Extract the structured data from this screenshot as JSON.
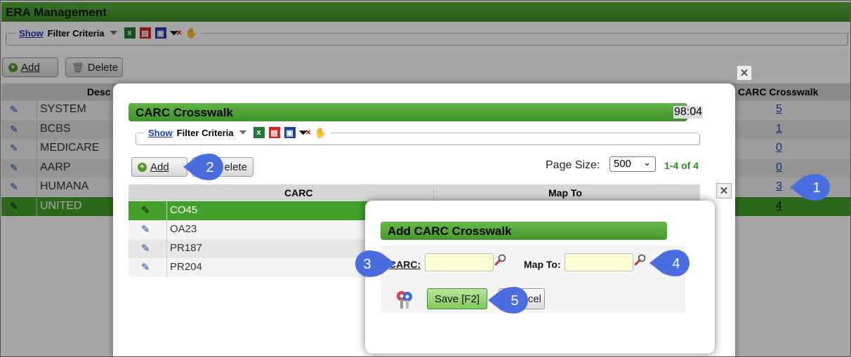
{
  "main": {
    "title": "ERA Management",
    "filter": {
      "show_label": "Show",
      "criteria_label": "Filter Criteria"
    },
    "add_label": "Add",
    "delete_label": "Delete",
    "columns": {
      "description": "Desc",
      "crosswalk": "CARC Crosswalk"
    },
    "rows": [
      {
        "description": "SYSTEM",
        "count": "5"
      },
      {
        "description": "BCBS",
        "count": "1"
      },
      {
        "description": "MEDICARE",
        "count": "0"
      },
      {
        "description": "AARP",
        "count": "0"
      },
      {
        "description": "HUMANA",
        "count": "3"
      },
      {
        "description": "UNITED",
        "count": "4"
      }
    ]
  },
  "crosswalk_dialog": {
    "title": "CARC Crosswalk",
    "timer": "98:04",
    "filter": {
      "show_label": "Show",
      "criteria_label": "Filter Criteria"
    },
    "add_label": "Add",
    "delete_label": "elete",
    "page_size_label": "Page Size:",
    "page_size_value": "500",
    "record_count": "1-4 of 4",
    "columns": {
      "carc": "CARC",
      "map_to": "Map To"
    },
    "rows": [
      {
        "carc": "CO45"
      },
      {
        "carc": "OA23"
      },
      {
        "carc": "PR187"
      },
      {
        "carc": "PR204"
      }
    ]
  },
  "add_dialog": {
    "title": "Add CARC Crosswalk",
    "carc_label": "CARC:",
    "map_to_label": "Map To:",
    "save_label": "Save [F2]",
    "cancel_label": "cel"
  },
  "callouts": [
    "1",
    "2",
    "3",
    "4",
    "5"
  ],
  "colors": {
    "accent_green": "#43a02a",
    "link_blue": "#1c44c4",
    "callout_blue": "#4a6ee0"
  }
}
